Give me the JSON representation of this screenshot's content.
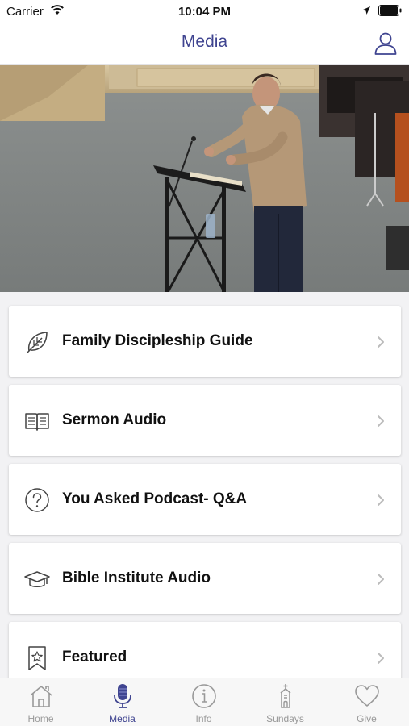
{
  "status_bar": {
    "carrier": "Carrier",
    "time": "10:04 PM"
  },
  "nav": {
    "title": "Media"
  },
  "hero": {
    "icon": "sermon-video-photo"
  },
  "menu_items": [
    {
      "label": "Family Discipleship Guide",
      "icon": "leaf-icon"
    },
    {
      "label": "Sermon Audio",
      "icon": "open-book-icon"
    },
    {
      "label": "You Asked Podcast- Q&A",
      "icon": "question-circle-icon"
    },
    {
      "label": "Bible Institute Audio",
      "icon": "graduation-cap-icon"
    },
    {
      "label": "Featured",
      "icon": "star-bookmark-icon"
    }
  ],
  "tabs": [
    {
      "label": "Home",
      "icon": "home-icon",
      "active": false
    },
    {
      "label": "Media",
      "icon": "microphone-icon",
      "active": true
    },
    {
      "label": "Info",
      "icon": "info-icon",
      "active": false
    },
    {
      "label": "Sundays",
      "icon": "church-icon",
      "active": false
    },
    {
      "label": "Give",
      "icon": "heart-icon",
      "active": false
    }
  ],
  "colors": {
    "accent": "#3f4490",
    "inactive": "#999999",
    "background": "#f2f2f4"
  }
}
